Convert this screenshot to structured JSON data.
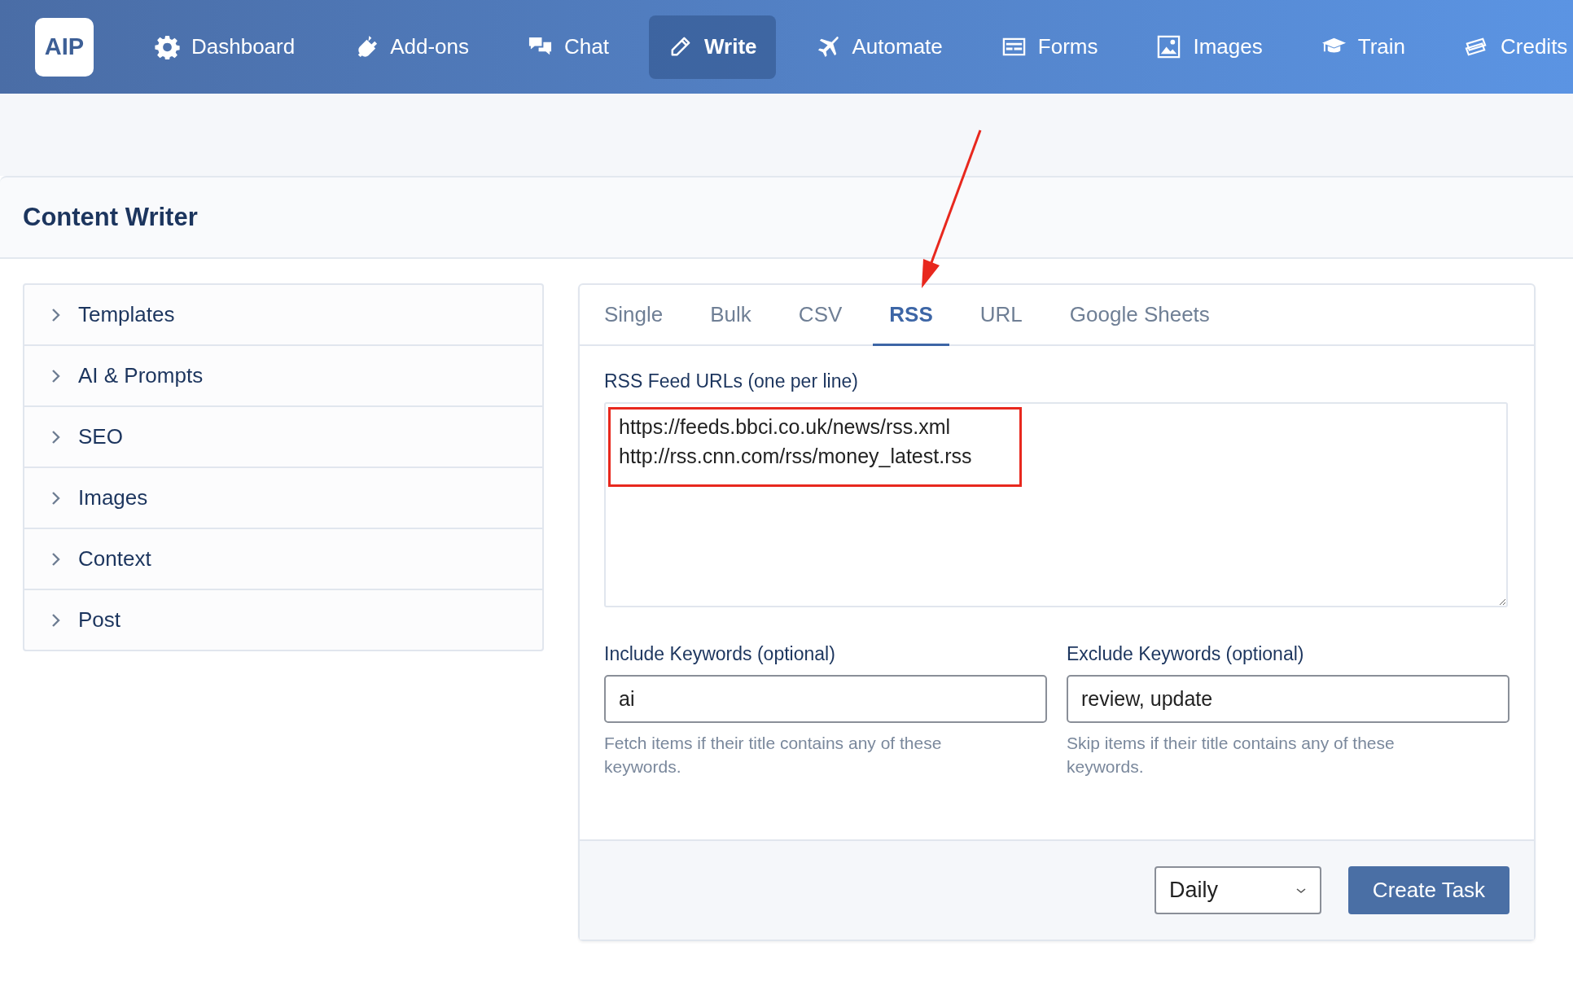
{
  "nav": {
    "logo": "AIP",
    "items": [
      {
        "label": "Dashboard",
        "kind": "gear",
        "selected": false
      },
      {
        "label": "Add-ons",
        "kind": "plug",
        "selected": false
      },
      {
        "label": "Chat",
        "kind": "chat",
        "selected": false
      },
      {
        "label": "Write",
        "kind": "pencil",
        "selected": true
      },
      {
        "label": "Automate",
        "kind": "plane",
        "selected": false
      },
      {
        "label": "Forms",
        "kind": "form",
        "selected": false
      },
      {
        "label": "Images",
        "kind": "image",
        "selected": false
      },
      {
        "label": "Train",
        "kind": "cap",
        "selected": false
      },
      {
        "label": "Credits",
        "kind": "bills",
        "selected": false
      }
    ]
  },
  "page": {
    "title": "Content Writer"
  },
  "sections": [
    {
      "label": "Templates",
      "expanded": false
    },
    {
      "label": "AI & Prompts",
      "expanded": false
    },
    {
      "label": "SEO",
      "expanded": false
    },
    {
      "label": "Images",
      "expanded": false
    },
    {
      "label": "Context",
      "expanded": false
    },
    {
      "label": "Post",
      "expanded": false
    }
  ],
  "tabs": [
    {
      "label": "Single",
      "selected": false
    },
    {
      "label": "Bulk",
      "selected": false
    },
    {
      "label": "CSV",
      "selected": false
    },
    {
      "label": "RSS",
      "selected": true
    },
    {
      "label": "URL",
      "selected": false
    },
    {
      "label": "Google Sheets",
      "selected": false
    }
  ],
  "feed": {
    "label": "RSS Feed URLs (one per line)",
    "value": [
      "https://feeds.bbci.co.uk/news/rss.xml",
      "http://rss.cnn.com/rss/money_latest.rss"
    ]
  },
  "include": {
    "label": "Include Keywords (optional)",
    "value": "ai",
    "help": "Fetch items if their title contains any of these keywords."
  },
  "exclude": {
    "label": "Exclude Keywords (optional)",
    "value": "review, update",
    "help": "Skip items if their title contains any of these keywords."
  },
  "schedule": {
    "value": "Daily"
  },
  "submit": "Create Task"
}
